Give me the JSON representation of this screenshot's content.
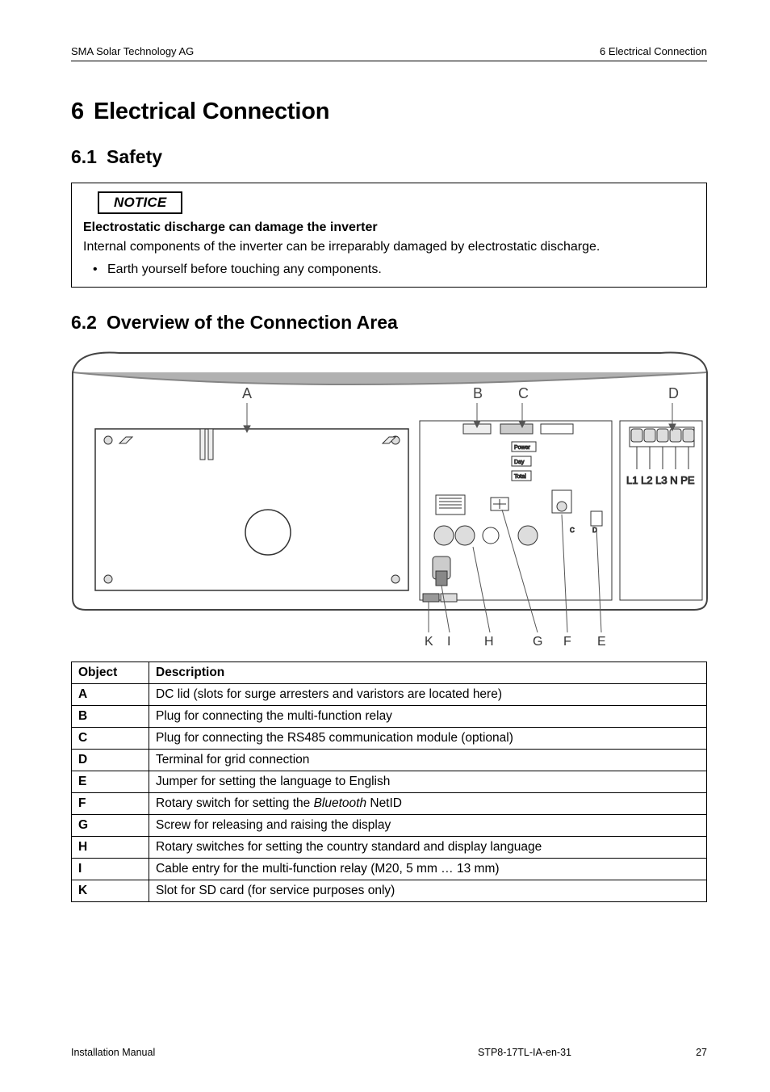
{
  "header": {
    "company": "SMA Solar Technology AG",
    "chapter": "6  Electrical Connection"
  },
  "h1": {
    "num": "6",
    "title": "Electrical Connection"
  },
  "sections": {
    "s61": {
      "num": "6.1",
      "title": "Safety"
    },
    "s62": {
      "num": "6.2",
      "title": "Overview of the Connection Area"
    }
  },
  "notice": {
    "label": "NOTICE",
    "title": "Electrostatic discharge can damage the inverter",
    "body": "Internal components of the inverter can be irreparably damaged by electrostatic discharge.",
    "bullet": "Earth yourself before touching any components."
  },
  "diagram": {
    "top_labels": [
      "A",
      "B",
      "C",
      "D"
    ],
    "bottom_labels": [
      "K",
      "I",
      "H",
      "G",
      "F",
      "E"
    ],
    "terminals": "L1  L2 L3 N PE",
    "panel": {
      "power": "Power",
      "day": "Day",
      "total": "Total",
      "c": "C",
      "d": "D"
    }
  },
  "table": {
    "head": {
      "object": "Object",
      "description": "Description"
    },
    "rows": [
      {
        "k": "A",
        "d": "DC lid (slots for surge arresters and varistors are located here)"
      },
      {
        "k": "B",
        "d": "Plug for connecting the multi-function relay"
      },
      {
        "k": "C",
        "d": "Plug for connecting the RS485 communication module (optional)"
      },
      {
        "k": "D",
        "d": "Terminal for grid connection"
      },
      {
        "k": "E",
        "d": "Jumper for setting the language to English"
      },
      {
        "k": "F",
        "d": "Rotary switch for setting the <i>Bluetooth</i> NetID"
      },
      {
        "k": "G",
        "d": "Screw for releasing and raising the display"
      },
      {
        "k": "H",
        "d": "Rotary switches for setting the country standard and display language"
      },
      {
        "k": "I",
        "d": "Cable entry for the multi-function relay (M20, 5 mm … 13 mm)"
      },
      {
        "k": "K",
        "d": "Slot for SD card (for service purposes only)"
      }
    ]
  },
  "footer": {
    "left": "Installation Manual",
    "mid": "STP8-17TL-IA-en-31",
    "page": "27"
  }
}
